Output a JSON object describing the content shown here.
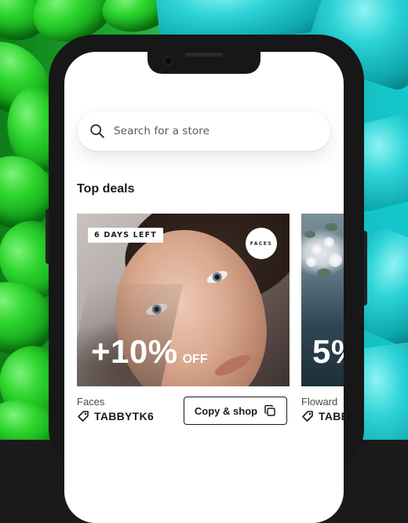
{
  "search": {
    "placeholder": "Search for a store"
  },
  "section": {
    "title": "Top deals"
  },
  "deals": [
    {
      "badge": "6 DAYS LEFT",
      "brand_logo": "FACES",
      "discount": "+10%",
      "discount_suffix": "OFF",
      "store": "Faces",
      "code": "TABBYTK6",
      "cta": "Copy & shop"
    },
    {
      "discount": "5%",
      "store": "Floward",
      "code": "TABBY"
    }
  ],
  "icons": {
    "search": "search-icon",
    "tag": "tag-icon",
    "copy": "copy-icon"
  },
  "colors": {
    "text": "#1a1a1a",
    "background": "#ffffff",
    "phone_frame": "#171717"
  }
}
